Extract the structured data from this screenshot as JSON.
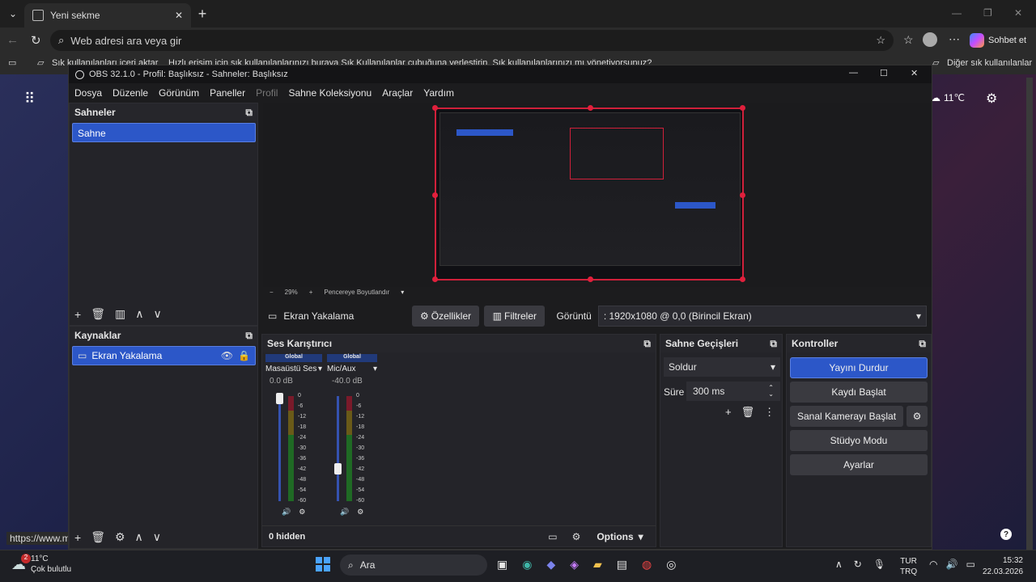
{
  "browser": {
    "tab_title": "Yeni sekme",
    "address_placeholder": "Web adresi ara veya gir",
    "copilot_label": "Sohbet et",
    "fav_left": "Sık kullanılanları içeri aktar",
    "fav_middle": "Hızlı erişim için sık kullanılanlarınızı buraya Sık Kullanılanlar çubuğuna yerleştirin. Sık kullanılanlarınızı mı yönetiyorsunuz?",
    "fav_right": "Diğer sık kullanılanlar",
    "status_url": "https://www.m",
    "weather_temp": "11℃"
  },
  "obs": {
    "title": "OBS 32.1.0 - Profil: Başlıksız - Sahneler: Başlıksız",
    "menu": [
      "Dosya",
      "Düzenle",
      "Görünüm",
      "Paneller",
      "Profil",
      "Sahne Koleksiyonu",
      "Araçlar",
      "Yardım"
    ],
    "scenes_title": "Sahneler",
    "scene_item": "Sahne",
    "sources_title": "Kaynaklar",
    "source_item": "Ekran Yakalama",
    "preview": {
      "zoom_minus": "−",
      "zoom": "29%",
      "zoom_plus": "+",
      "fit_label": "Pencereye Boyutlandır"
    },
    "source_bar": {
      "name": "Ekran Yakalama",
      "properties": "Özellikler",
      "filters": "Filtreler",
      "display_label": "Görüntü",
      "display_value": ": 1920x1080 @ 0,0 (Birincil Ekran)"
    },
    "mixer": {
      "title": "Ses Karıştırıcı",
      "channels": [
        {
          "tag": "Global",
          "name": "Masaüstü Ses",
          "db": "0.0 dB",
          "fader": 1.0
        },
        {
          "tag": "Global",
          "name": "Mic/Aux",
          "db": "-40.0 dB",
          "fader": 0.33
        }
      ],
      "ticks": [
        "0",
        "-6",
        "-12",
        "-18",
        "-24",
        "-30",
        "-36",
        "-42",
        "-48",
        "-54",
        "-60"
      ],
      "hidden": "0 hidden",
      "options": "Options"
    },
    "transitions": {
      "title": "Sahne Geçişleri",
      "type": "Soldur",
      "duration_label": "Süre",
      "duration_value": "300 ms"
    },
    "controls": {
      "title": "Kontroller",
      "stop_stream": "Yayını Durdur",
      "start_record": "Kaydı Başlat",
      "start_vcam": "Sanal Kamerayı Başlat",
      "studio_mode": "Stüdyo Modu",
      "settings": "Ayarlar"
    }
  },
  "taskbar": {
    "weather_temp": "11°C",
    "weather_desc": "Çok bulutlu",
    "weather_badge": "2",
    "search": "Ara",
    "lang1": "TUR",
    "lang2": "TRQ",
    "time": "15:32",
    "date": "22.03.2026"
  },
  "colors": {
    "accent": "#2c57c8",
    "record_red": "#d0203a"
  }
}
